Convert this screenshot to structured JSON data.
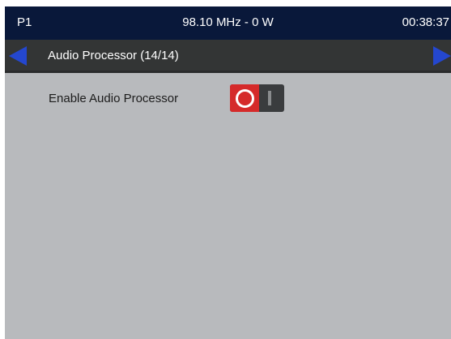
{
  "status": {
    "preset": "P1",
    "frequency_power": "98.10 MHz - 0 W",
    "clock": "00:38:37"
  },
  "nav": {
    "title": "Audio Processor (14/14)",
    "prev_icon": "arrow-left-icon",
    "next_icon": "arrow-right-icon"
  },
  "settings": [
    {
      "label": "Enable Audio Processor",
      "value": "off"
    }
  ],
  "colors": {
    "status_bg": "#09183a",
    "nav_bg": "#333535",
    "screen_bg": "#b8babd",
    "arrow": "#2447cf",
    "toggle_off": "#d52a2a",
    "toggle_track": "#3a3c3e"
  }
}
